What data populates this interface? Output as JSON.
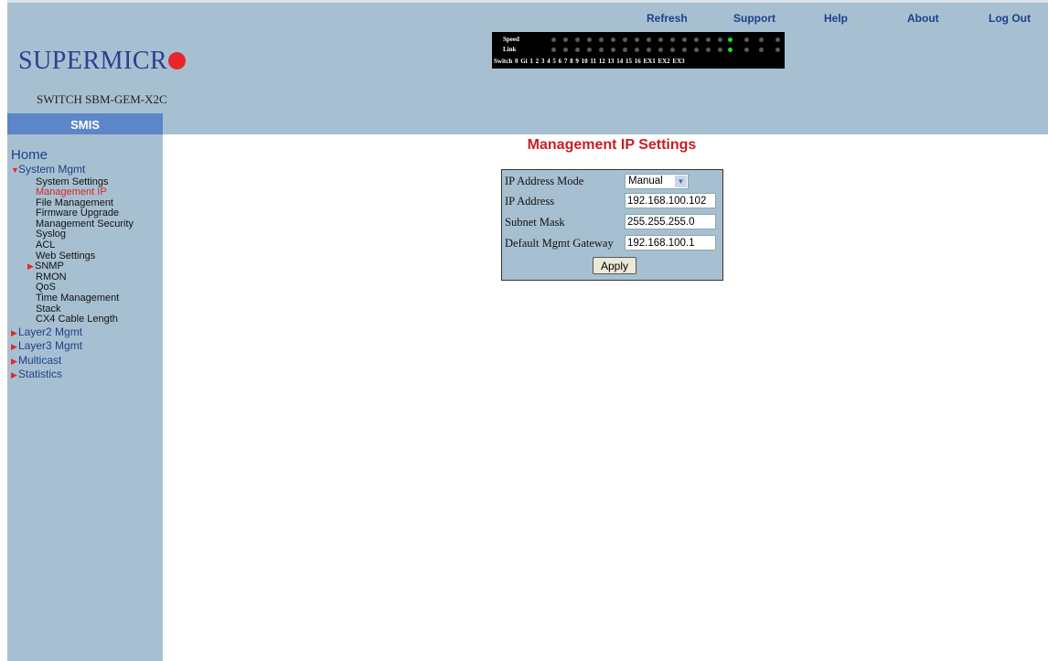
{
  "header": {
    "logo_text": "SUPERMICR",
    "model": "SWITCH SBM-GEM-X2C",
    "app_label": "SMIS",
    "nav": [
      "Refresh",
      "Support",
      "Help",
      "About",
      "Log Out"
    ],
    "ports": {
      "speed_label": "Speed",
      "link_label": "Link",
      "numbers_label": "Switch 0 Gi 1 2 3 4 5 6 7 8 9 10 11 12 13 14 15 16 EX1 EX2 EX3"
    }
  },
  "sidebar": {
    "home": "Home",
    "sections": [
      {
        "label": "System Mgmt",
        "expanded": true
      },
      {
        "label": "Layer2 Mgmt"
      },
      {
        "label": "Layer3 Mgmt"
      },
      {
        "label": "Multicast"
      },
      {
        "label": "Statistics"
      }
    ],
    "system_items": [
      "System Settings",
      "Management IP",
      "File Management",
      "Firmware Upgrade",
      "Management Security",
      "Syslog",
      "ACL",
      "Web Settings"
    ],
    "snmp": "SNMP",
    "system_items_2": [
      "RMON",
      "QoS",
      "Time Management",
      "Stack",
      "CX4 Cable Length"
    ]
  },
  "main": {
    "title": "Management IP Settings",
    "fields": {
      "mode_label": "IP Address Mode",
      "mode_value": "Manual",
      "ip_label": "IP Address",
      "ip_value": "192.168.100.102",
      "mask_label": "Subnet Mask",
      "mask_value": "255.255.255.0",
      "gw_label": "Default Mgmt Gateway",
      "gw_value": "192.168.100.1"
    },
    "apply_label": "Apply"
  },
  "colors": {
    "panel_bg": "#a7c0d1",
    "smis_bg": "#5c86c7",
    "title": "#c81e24",
    "logo": "#2c3e8f",
    "link_led": "#22dd22"
  }
}
